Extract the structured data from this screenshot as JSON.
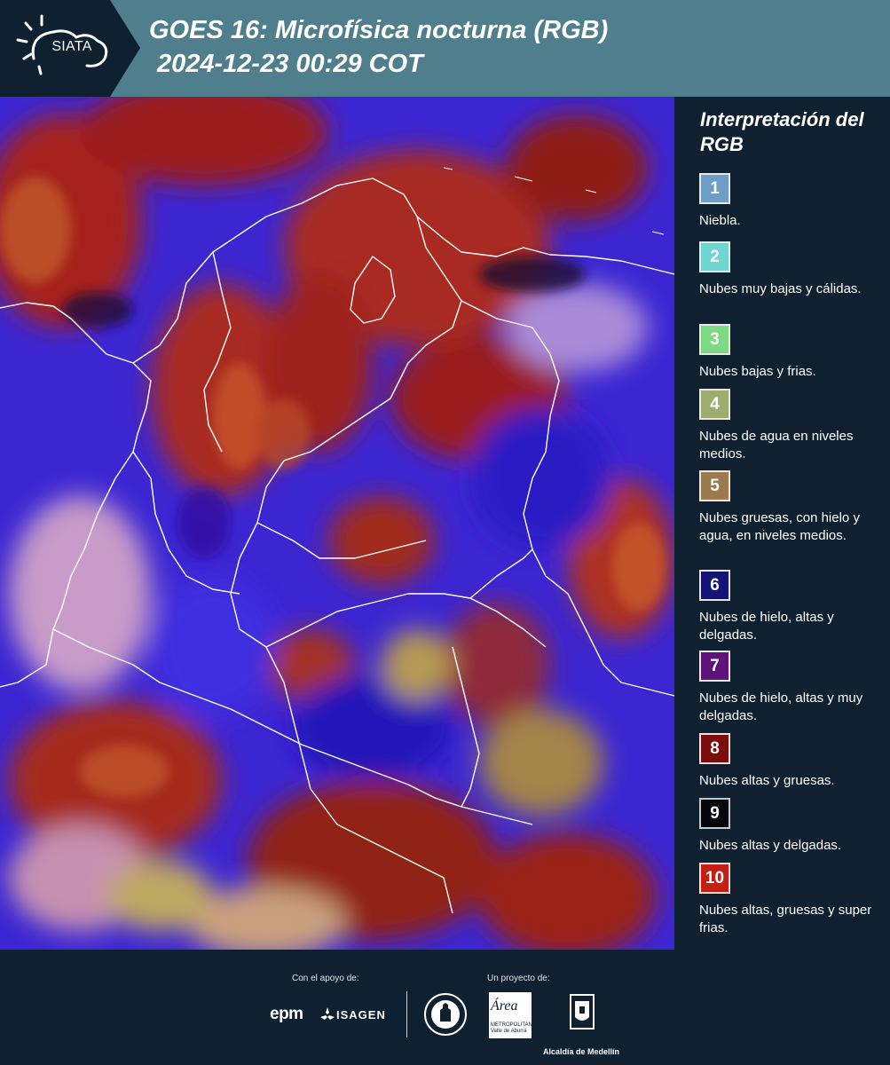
{
  "header": {
    "logo_text": "SIATA",
    "title_line1": "GOES 16: Microfísica nocturna (RGB)",
    "title_line2": "2024-12-23 00:29 COT"
  },
  "legend": {
    "title": "Interpretación del RGB",
    "items": [
      {
        "num": "1",
        "label": "Niebla.",
        "color": "#6e9dc8"
      },
      {
        "num": "2",
        "label": "Nubes muy bajas y cálidas.",
        "color": "#6fd6cf"
      },
      {
        "num": "3",
        "label": "Nubes bajas y frias.",
        "color": "#7fd883"
      },
      {
        "num": "4",
        "label": "Nubes de agua en niveles medios.",
        "color": "#9fac70"
      },
      {
        "num": "5",
        "label": "Nubes gruesas, con hielo y agua, en niveles medios.",
        "color": "#9a7a4e"
      },
      {
        "num": "6",
        "label": "Nubes de hielo, altas y delgadas.",
        "color": "#141478"
      },
      {
        "num": "7",
        "label": "Nubes de hielo, altas y muy delgadas.",
        "color": "#5e137a"
      },
      {
        "num": "8",
        "label": "Nubes altas y gruesas.",
        "color": "#7c0d0d"
      },
      {
        "num": "9",
        "label": "Nubes altas y delgadas.",
        "color": "#05070d"
      },
      {
        "num": "10",
        "label": "Nubes altas, gruesas y super frias.",
        "color": "#c41f12"
      }
    ]
  },
  "footer": {
    "support_label": "Con el apoyo de:",
    "project_label": "Un proyecto de:",
    "brand_epm": "epm",
    "brand_isagen": "ISAGEN",
    "brand_area": "Área",
    "brand_area_sub": "METROPOLITANA Valle de Aburrá",
    "brand_alcaldia": "Alcaldía de Medellín"
  }
}
